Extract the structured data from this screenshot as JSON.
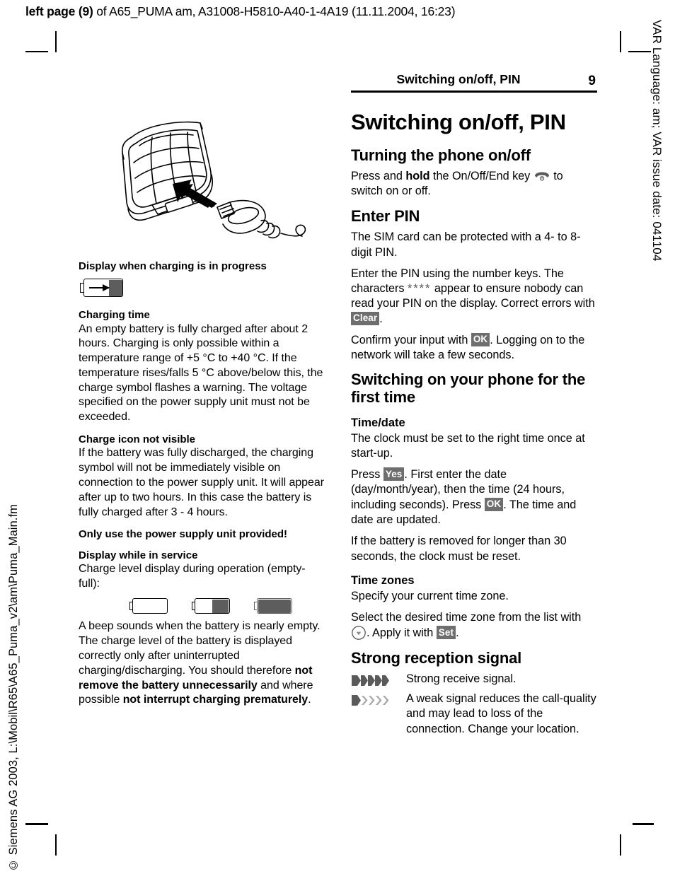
{
  "header": {
    "prefix_bold": "left page (9)",
    "rest": " of A65_PUMA am, A31008-H5810-A40-1-4A19 (11.11.2004, 16:23)"
  },
  "side_notes": {
    "right_vertical": "VAR Language: am; VAR issue date: 041104",
    "left_vertical": "© Siemens AG 2003, L:\\Mobil\\R65\\A65_Puma_v2\\am\\Puma_Main.fm"
  },
  "running_head": {
    "title": "Switching on/off, PIN",
    "page_number": "9"
  },
  "left_column": {
    "figure_caption": "Display when charging is in progress",
    "charging_icon_name": "battery-charging-icon",
    "sections": [
      {
        "heading": "Charging time",
        "body": "An empty battery is fully charged after about 2 hours. Charging is only possible within a temperature range of +5 °C to +40 °C. If the temperature rises/falls 5 °C above/below this, the charge symbol flashes a warning. The voltage specified on the power supply unit must not be exceeded."
      },
      {
        "heading": "Charge icon not visible",
        "body": "If the battery was fully discharged, the charging symbol will not be immediately visible on connection to the power supply unit. It will appear after up to two hours. In this case the battery is fully charged after 3 - 4 hours."
      }
    ],
    "notice": "Only use the power supply unit provided!",
    "in_service": {
      "heading": "Display while in service",
      "body": "Charge level display during operation (empty-full):",
      "battery_levels": [
        {
          "name": "battery-empty-icon",
          "fill_percent": 0
        },
        {
          "name": "battery-half-icon",
          "fill_percent": 50
        },
        {
          "name": "battery-full-icon",
          "fill_percent": 100
        }
      ],
      "beep_text_1": "A beep sounds when the battery is nearly empty. The charge level of the battery is displayed correctly only after uninterrupted charging/discharging. You should therefore ",
      "beep_bold_1": "not remove the battery unnecessarily",
      "beep_text_2": " and where possible ",
      "beep_bold_2": "not interrupt charging prematurely",
      "beep_text_3": "."
    }
  },
  "right_column": {
    "title": "Switching on/off, PIN",
    "turning": {
      "heading": "Turning the phone on/off",
      "text_1": "Press and ",
      "bold_1": "hold",
      "text_2": " the On/Off/End key ",
      "icon": "end-key-icon",
      "text_3": " to switch on or off."
    },
    "enter_pin": {
      "heading": "Enter PIN",
      "p1": "The SIM card can be protected with a 4- to 8-digit PIN.",
      "p2_a": "Enter the PIN using the number keys. The characters ",
      "p2_stars": "****",
      "p2_b": " appear to ensure nobody can read your PIN on the display. Correct errors with ",
      "p2_key": "Clear",
      "p2_c": ".",
      "p3_a": "Confirm your input with ",
      "p3_key": "OK",
      "p3_b": ". Logging on to the network will take a few seconds."
    },
    "first_time": {
      "heading": "Switching on your phone for the first time",
      "time_date": {
        "heading": "Time/date",
        "p1": "The clock must be set to the right time once at start-up.",
        "p2_a": "Press ",
        "p2_key1": "Yes",
        "p2_b": ". First enter the date (day/month/year), then the time (24 hours, including seconds). Press ",
        "p2_key2": "OK",
        "p2_c": ". The time and date are updated.",
        "p3": "If the battery is removed for longer than 30 seconds, the clock must be reset."
      },
      "time_zones": {
        "heading": "Time zones",
        "p1": "Specify your current time zone.",
        "p2_a": "Select the desired time zone from the list with ",
        "p2_icon": "nav-down-key-icon",
        "p2_b": ". Apply it with ",
        "p2_key": "Set",
        "p2_c": "."
      }
    },
    "reception": {
      "heading": "Strong reception signal",
      "rows": [
        {
          "icon": "signal-strong-icon",
          "text": "Strong receive signal."
        },
        {
          "icon": "signal-weak-icon",
          "text": "A weak signal reduces the call-quality and may lead to loss of the connection. Change your location."
        }
      ]
    }
  },
  "colors": {
    "softkey_bg": "#6e6e6e",
    "battery_fill": "#5d5d5d",
    "signal_dark": "#5a5a5a",
    "signal_light": "#9e9e9e",
    "rule": "#000000"
  }
}
